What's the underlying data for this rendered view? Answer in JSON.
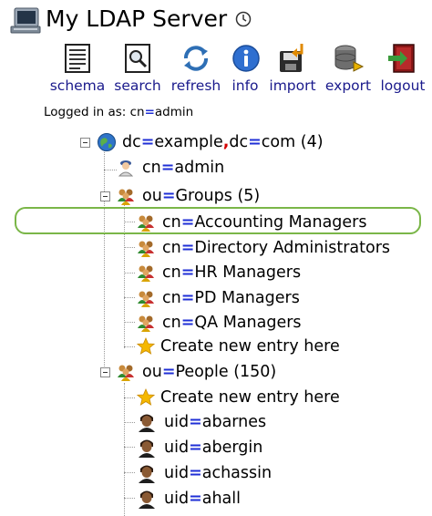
{
  "app": {
    "title": "My LDAP Server"
  },
  "toolbar": {
    "schema": "schema",
    "search": "search",
    "refresh": "refresh",
    "info": "info",
    "import": "import",
    "export": "export",
    "logout": "logout"
  },
  "login": {
    "prefix": "Logged in as: ",
    "attr": "cn",
    "value": "admin"
  },
  "tree": {
    "root": {
      "part1_attr": "dc",
      "part1_value": "example",
      "part2_attr": "dc",
      "part2_value": "com",
      "count": "(4)"
    },
    "admin": {
      "attr": "cn",
      "value": "admin"
    },
    "groups": {
      "attr": "ou",
      "value": "Groups",
      "count": "(5)"
    },
    "group_items": [
      {
        "attr": "cn",
        "value": "Accounting Managers"
      },
      {
        "attr": "cn",
        "value": "Directory Administrators"
      },
      {
        "attr": "cn",
        "value": "HR Managers"
      },
      {
        "attr": "cn",
        "value": "PD Managers"
      },
      {
        "attr": "cn",
        "value": "QA Managers"
      }
    ],
    "create_label": "Create new entry here",
    "people": {
      "attr": "ou",
      "value": "People",
      "count": "(150)"
    },
    "people_items": [
      {
        "attr": "uid",
        "value": "abarnes"
      },
      {
        "attr": "uid",
        "value": "abergin"
      },
      {
        "attr": "uid",
        "value": "achassin"
      },
      {
        "attr": "uid",
        "value": "ahall"
      }
    ]
  },
  "colors": {
    "equals": "#1f2fd6",
    "comma": "#d40000",
    "highlight": "#7ab648",
    "link": "#1a1a8c"
  }
}
